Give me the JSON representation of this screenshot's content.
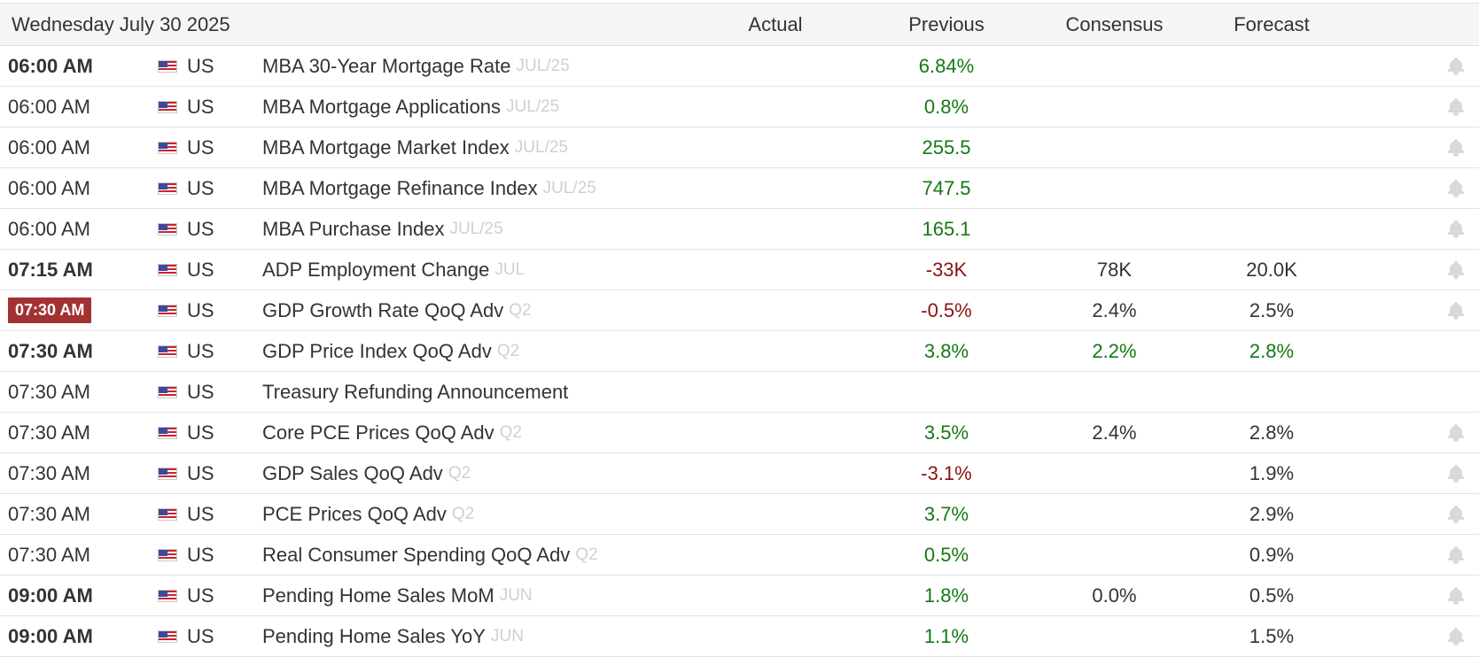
{
  "header": {
    "date": "Wednesday July 30 2025",
    "col_actual": "Actual",
    "col_previous": "Previous",
    "col_consensus": "Consensus",
    "col_forecast": "Forecast"
  },
  "colors": {
    "positive": "#137a13",
    "negative": "#8a1212",
    "highlight_badge": "#a23232",
    "reference_text": "#d0d0d0"
  },
  "rows": [
    {
      "time": "06:00 AM",
      "time_style": "bold",
      "country": "US",
      "event": "MBA 30-Year Mortgage Rate",
      "ref": "JUL/25",
      "actual": "",
      "previous": "6.84%",
      "previous_color": "green",
      "consensus": "",
      "consensus_color": "neutral",
      "forecast": "",
      "forecast_color": "neutral",
      "bell": true
    },
    {
      "time": "06:00 AM",
      "time_style": "normal",
      "country": "US",
      "event": "MBA Mortgage Applications",
      "ref": "JUL/25",
      "actual": "",
      "previous": "0.8%",
      "previous_color": "green",
      "consensus": "",
      "consensus_color": "neutral",
      "forecast": "",
      "forecast_color": "neutral",
      "bell": true
    },
    {
      "time": "06:00 AM",
      "time_style": "normal",
      "country": "US",
      "event": "MBA Mortgage Market Index",
      "ref": "JUL/25",
      "actual": "",
      "previous": "255.5",
      "previous_color": "green",
      "consensus": "",
      "consensus_color": "neutral",
      "forecast": "",
      "forecast_color": "neutral",
      "bell": true
    },
    {
      "time": "06:00 AM",
      "time_style": "normal",
      "country": "US",
      "event": "MBA Mortgage Refinance Index",
      "ref": "JUL/25",
      "actual": "",
      "previous": "747.5",
      "previous_color": "green",
      "consensus": "",
      "consensus_color": "neutral",
      "forecast": "",
      "forecast_color": "neutral",
      "bell": true
    },
    {
      "time": "06:00 AM",
      "time_style": "normal",
      "country": "US",
      "event": "MBA Purchase Index",
      "ref": "JUL/25",
      "actual": "",
      "previous": "165.1",
      "previous_color": "green",
      "consensus": "",
      "consensus_color": "neutral",
      "forecast": "",
      "forecast_color": "neutral",
      "bell": true
    },
    {
      "time": "07:15 AM",
      "time_style": "bold",
      "country": "US",
      "event": "ADP Employment Change",
      "ref": "JUL",
      "actual": "",
      "previous": "-33K",
      "previous_color": "red",
      "consensus": "78K",
      "consensus_color": "neutral",
      "forecast": "20.0K",
      "forecast_color": "neutral",
      "bell": true
    },
    {
      "time": "07:30 AM",
      "time_style": "badge",
      "country": "US",
      "event": "GDP Growth Rate QoQ Adv",
      "ref": "Q2",
      "actual": "",
      "previous": "-0.5%",
      "previous_color": "red",
      "consensus": "2.4%",
      "consensus_color": "neutral",
      "forecast": "2.5%",
      "forecast_color": "neutral",
      "bell": true
    },
    {
      "time": "07:30 AM",
      "time_style": "bold",
      "country": "US",
      "event": "GDP Price Index QoQ Adv",
      "ref": "Q2",
      "actual": "",
      "previous": "3.8%",
      "previous_color": "green",
      "consensus": "2.2%",
      "consensus_color": "green",
      "forecast": "2.8%",
      "forecast_color": "green",
      "bell": false
    },
    {
      "time": "07:30 AM",
      "time_style": "normal",
      "country": "US",
      "event": "Treasury Refunding Announcement",
      "ref": "",
      "actual": "",
      "previous": "",
      "previous_color": "neutral",
      "consensus": "",
      "consensus_color": "neutral",
      "forecast": "",
      "forecast_color": "neutral",
      "bell": false
    },
    {
      "time": "07:30 AM",
      "time_style": "normal",
      "country": "US",
      "event": "Core PCE Prices QoQ Adv",
      "ref": "Q2",
      "actual": "",
      "previous": "3.5%",
      "previous_color": "green",
      "consensus": "2.4%",
      "consensus_color": "neutral",
      "forecast": "2.8%",
      "forecast_color": "neutral",
      "bell": true
    },
    {
      "time": "07:30 AM",
      "time_style": "normal",
      "country": "US",
      "event": "GDP Sales QoQ Adv",
      "ref": "Q2",
      "actual": "",
      "previous": "-3.1%",
      "previous_color": "red",
      "consensus": "",
      "consensus_color": "neutral",
      "forecast": "1.9%",
      "forecast_color": "neutral",
      "bell": true
    },
    {
      "time": "07:30 AM",
      "time_style": "normal",
      "country": "US",
      "event": "PCE Prices QoQ Adv",
      "ref": "Q2",
      "actual": "",
      "previous": "3.7%",
      "previous_color": "green",
      "consensus": "",
      "consensus_color": "neutral",
      "forecast": "2.9%",
      "forecast_color": "neutral",
      "bell": true
    },
    {
      "time": "07:30 AM",
      "time_style": "normal",
      "country": "US",
      "event": "Real Consumer Spending QoQ Adv",
      "ref": "Q2",
      "actual": "",
      "previous": "0.5%",
      "previous_color": "green",
      "consensus": "",
      "consensus_color": "neutral",
      "forecast": "0.9%",
      "forecast_color": "neutral",
      "bell": true
    },
    {
      "time": "09:00 AM",
      "time_style": "bold",
      "country": "US",
      "event": "Pending Home Sales MoM",
      "ref": "JUN",
      "actual": "",
      "previous": "1.8%",
      "previous_color": "green",
      "consensus": "0.0%",
      "consensus_color": "neutral",
      "forecast": "0.5%",
      "forecast_color": "neutral",
      "bell": true
    },
    {
      "time": "09:00 AM",
      "time_style": "bold",
      "country": "US",
      "event": "Pending Home Sales YoY",
      "ref": "JUN",
      "actual": "",
      "previous": "1.1%",
      "previous_color": "green",
      "consensus": "",
      "consensus_color": "neutral",
      "forecast": "1.5%",
      "forecast_color": "neutral",
      "bell": true
    }
  ]
}
